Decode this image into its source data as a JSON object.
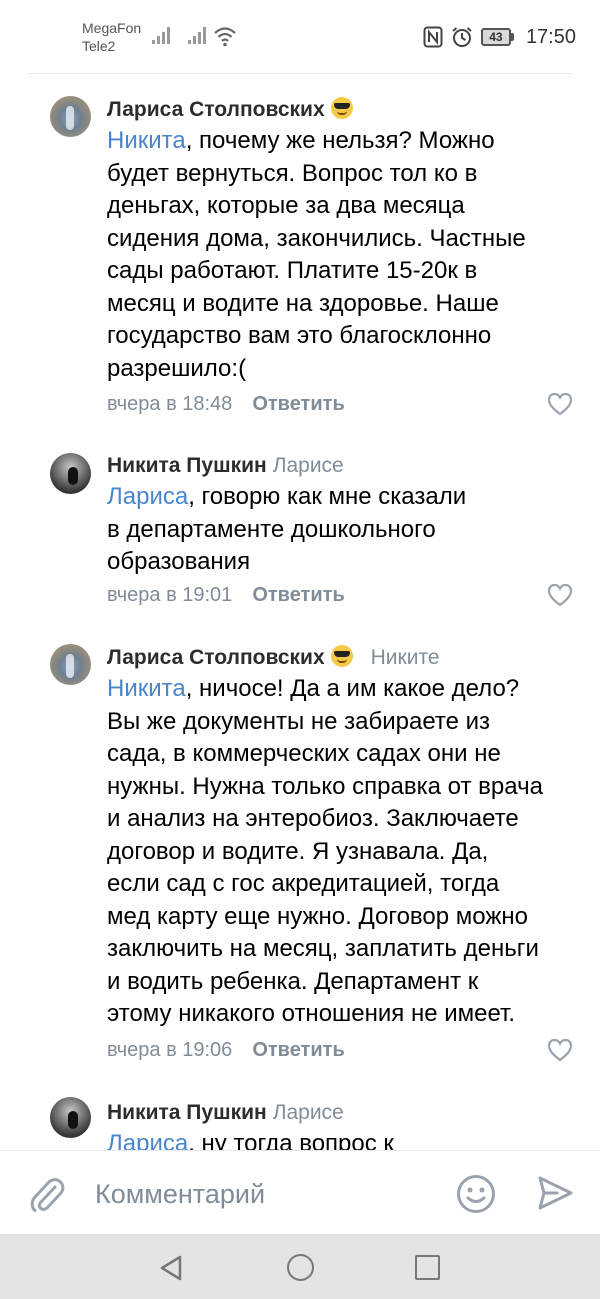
{
  "status_bar": {
    "carrier_1": "MegaFon",
    "carrier_2": "Tele2",
    "battery": "43",
    "time": "17:50",
    "icons": [
      "signal-icon",
      "signal-icon",
      "wifi-icon",
      "nfc-icon",
      "alarm-icon",
      "battery-icon"
    ]
  },
  "comments": [
    {
      "author": "Лариса Столповских",
      "emoji": "sunglasses-emoji",
      "reply_to": "",
      "mention": "Никита",
      "lines": [
        ", почему же нельзя? Можно",
        "будет вернуться. Вопрос тол ко в",
        "деньгах, которые за два месяца",
        "сидения дома, закончились. Частные",
        "сады работают. Платите 15-20к в",
        "месяц и водите на здоровье. Наше",
        "государство вам это благосклонно",
        "разрешило:("
      ],
      "time": "вчера в 18:48",
      "reply_label": "Ответить"
    },
    {
      "author": "Никита Пушкин",
      "reply_to": "Ларисе",
      "mention": "Лариса",
      "lines": [
        ", говорю как мне сказали",
        "в департаменте дошкольного",
        "образования"
      ],
      "time": "вчера в 19:01",
      "reply_label": "Ответить"
    },
    {
      "author": "Лариса Столповских",
      "emoji": "sunglasses-emoji",
      "reply_to": "Никите",
      "mention": "Никита",
      "lines": [
        ", ничосе! Да а им какое дело?",
        "Вы же документы не забираете из",
        "сада, в коммерческих садах они не",
        "нужны. Нужна только справка от врача",
        "и анализ на энтеробиоз. Заключаете",
        "договор и водите. Я узнавала. Да,",
        "если сад с гос акредитацией, тогда",
        "мед карту еще нужно. Договор можно",
        "заключить на месяц, заплатить деньги",
        "и водить ребенка. Департамент к",
        "этому никакого отношения не имеет."
      ],
      "time": "вчера в 19:06",
      "reply_label": "Ответить"
    },
    {
      "author": "Никита Пушкин",
      "reply_to": "Ларисе",
      "mention": "Лариса",
      "lines": [
        ", ну тогда вопрос к"
      ]
    }
  ],
  "input": {
    "placeholder": "Комментарий"
  },
  "colors": {
    "link": "#4986cc",
    "secondary": "#818c99",
    "author": "#2c2d2e"
  }
}
